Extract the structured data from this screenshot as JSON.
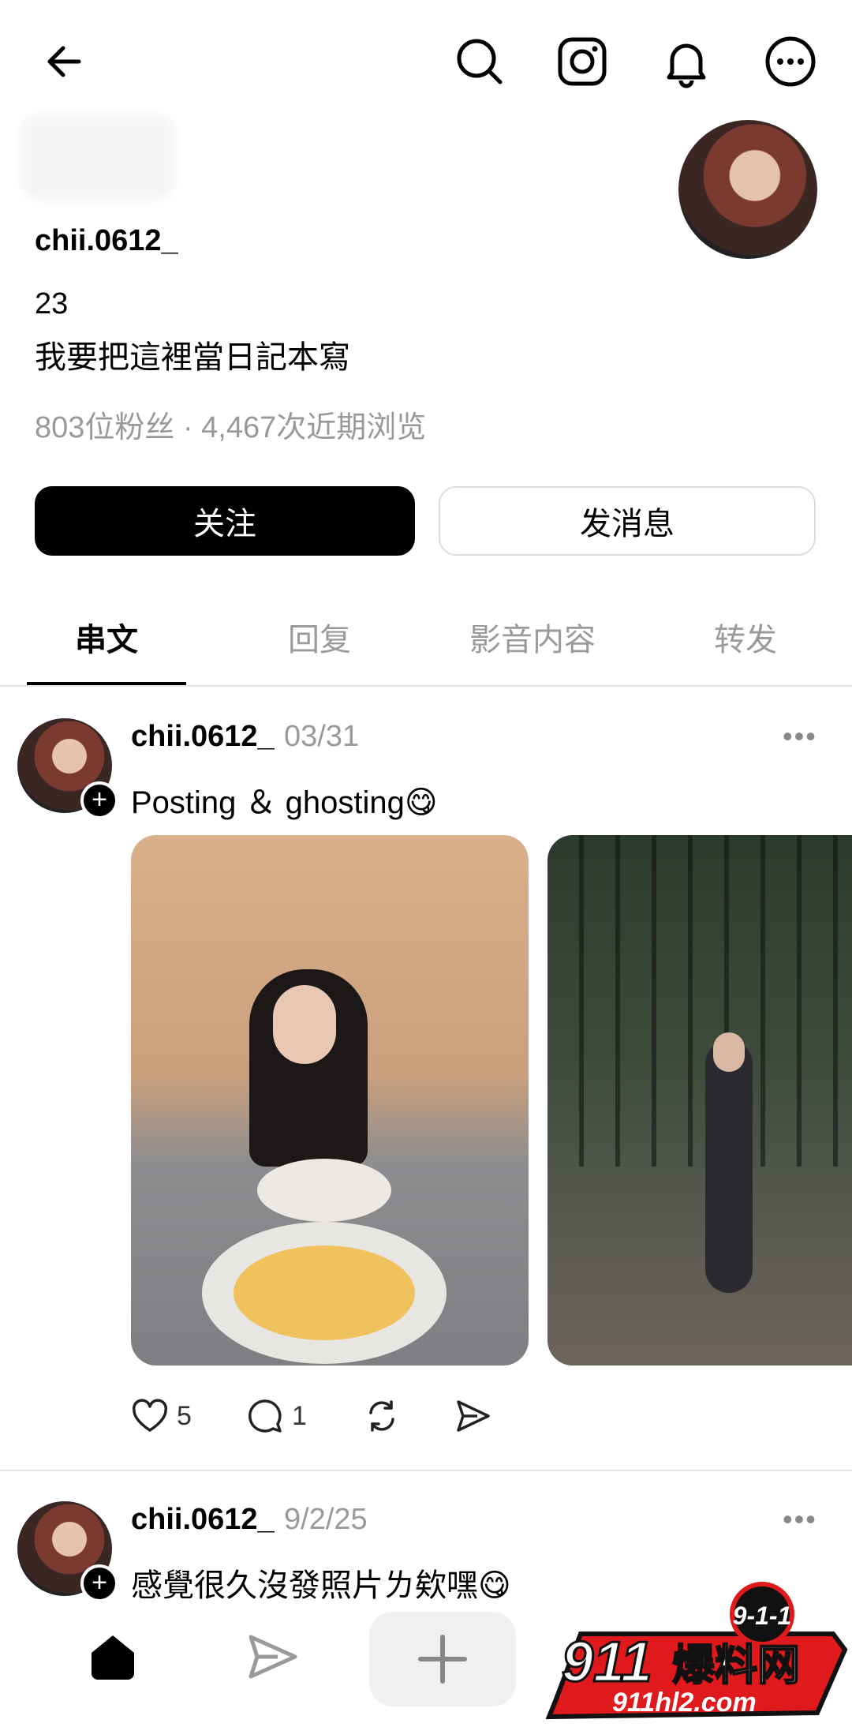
{
  "profile": {
    "username": "chii.0612_",
    "bio_line1": "23",
    "bio_line2": "我要把這裡當日記本寫",
    "stats": "803位粉丝 · 4,467次近期浏览"
  },
  "buttons": {
    "follow": "关注",
    "message": "发消息"
  },
  "tabs": [
    "串文",
    "回复",
    "影音内容",
    "转发"
  ],
  "posts": [
    {
      "username": "chii.0612_",
      "date": "03/31",
      "text": "Posting ＆ ghosting😋",
      "likes": "5",
      "comments": "1"
    },
    {
      "username": "chii.0612_",
      "date": "9/2/25",
      "text": "感覺很久沒發照片ㄌ欸嘿😋"
    }
  ],
  "watermark": {
    "badge": "9-1-1",
    "brand_num": "911",
    "brand_cn": "爆料网",
    "url": "911hl2.com"
  },
  "icons": {
    "back": "back-arrow-icon",
    "search": "search-icon",
    "instagram": "instagram-icon",
    "bell": "bell-icon",
    "more": "more-icon"
  },
  "colors": {
    "primary": "#000000",
    "muted": "#9a9a9a",
    "divider": "#e6e6e6",
    "watermark_red": "#e0191d"
  }
}
